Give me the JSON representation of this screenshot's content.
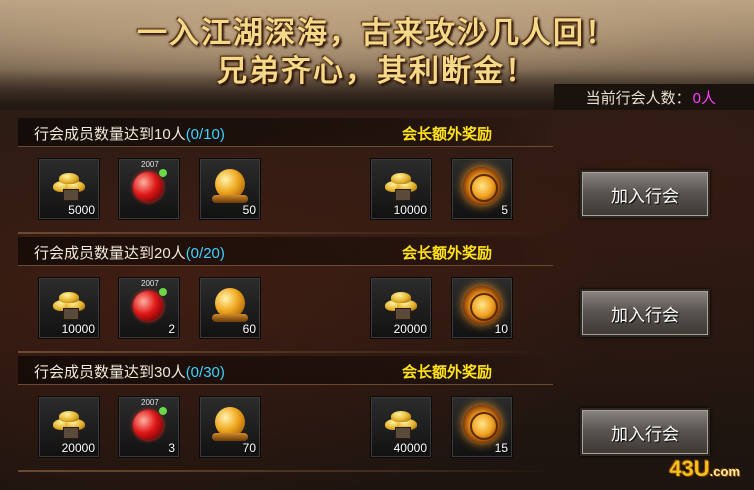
{
  "banner": {
    "line1": "一入江湖深海，古来攻沙几人回！",
    "line2": "兄弟齐心，其利断金！"
  },
  "member_count": {
    "label": "当前行会人数：",
    "value": "0人"
  },
  "tiers": [
    {
      "title": "行会成员数量达到10人",
      "progress": "(0/10)",
      "leader_label": "会长额外奖励",
      "rewards": [
        {
          "icon": "gold-ingot-icon",
          "qty": "5000"
        },
        {
          "icon": "red-orb-icon",
          "qty": "",
          "badge": "2007"
        },
        {
          "icon": "amber-orb-icon",
          "qty": "50"
        }
      ],
      "leader_rewards": [
        {
          "icon": "gold-ingot-icon",
          "qty": "10000"
        },
        {
          "icon": "sun-orb-icon",
          "qty": "5"
        }
      ],
      "button": "加入行会"
    },
    {
      "title": "行会成员数量达到20人",
      "progress": "(0/20)",
      "leader_label": "会长额外奖励",
      "rewards": [
        {
          "icon": "gold-ingot-icon",
          "qty": "10000"
        },
        {
          "icon": "red-orb-icon",
          "qty": "2",
          "badge": "2007"
        },
        {
          "icon": "amber-orb-icon",
          "qty": "60"
        }
      ],
      "leader_rewards": [
        {
          "icon": "gold-ingot-icon",
          "qty": "20000"
        },
        {
          "icon": "sun-orb-icon",
          "qty": "10"
        }
      ],
      "button": "加入行会"
    },
    {
      "title": "行会成员数量达到30人",
      "progress": "(0/30)",
      "leader_label": "会长额外奖励",
      "rewards": [
        {
          "icon": "gold-ingot-icon",
          "qty": "20000"
        },
        {
          "icon": "red-orb-icon",
          "qty": "3",
          "badge": "2007"
        },
        {
          "icon": "amber-orb-icon",
          "qty": "70"
        }
      ],
      "leader_rewards": [
        {
          "icon": "gold-ingot-icon",
          "qty": "40000"
        },
        {
          "icon": "sun-orb-icon",
          "qty": "15"
        }
      ],
      "button": "加入行会"
    }
  ],
  "watermark": {
    "text": "43U",
    "suffix": ".com"
  },
  "colors": {
    "progress": "#3cd2ff",
    "leader_label": "#ffe21a",
    "member_value": "#ff3cff",
    "slogan": "#f4d98a"
  }
}
